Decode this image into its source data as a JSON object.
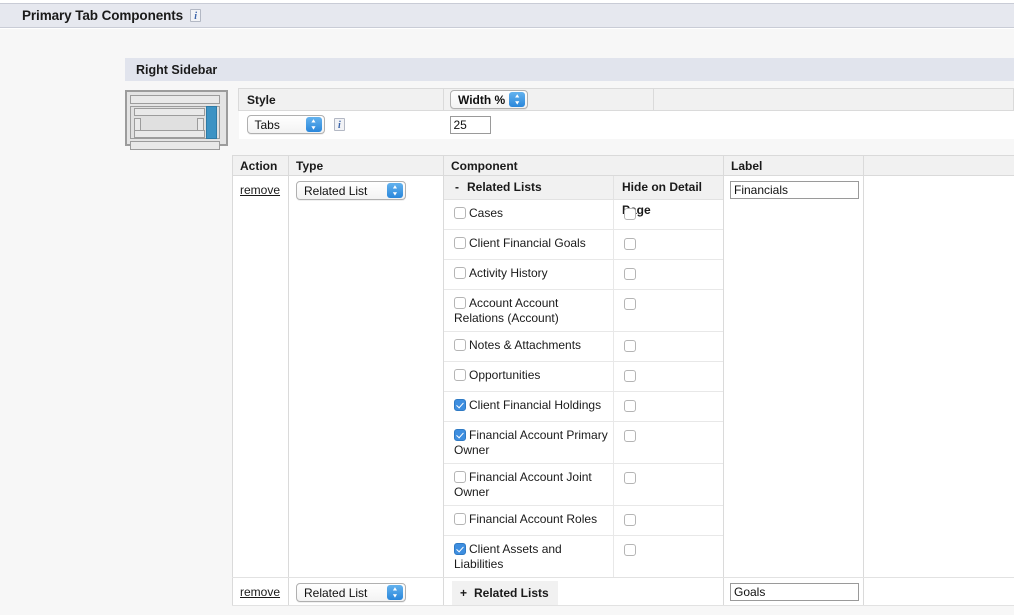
{
  "header": {
    "title": "Primary Tab Components",
    "info_icon": "info-icon",
    "info_label": "i"
  },
  "panel": {
    "title": "Right Sidebar",
    "thumbnail_name": "layout-preview-right-sidebar",
    "accent_color": "#3d93c4"
  },
  "style_section": {
    "style_header": "Style",
    "width_header_label": "Width %",
    "style_value": "Tabs",
    "style_info_label": "i",
    "width_value": "25"
  },
  "table": {
    "columns": [
      "Action",
      "Type",
      "Component",
      "Label"
    ],
    "rows": [
      {
        "action": "remove",
        "type": "Related List",
        "label": "Financials",
        "component": {
          "title": "Related Lists",
          "toggle": "-",
          "hide_column_header": "Hide on Detail Page",
          "items": [
            {
              "name": "Cases",
              "checked": false,
              "hide": false
            },
            {
              "name": "Client Financial Goals",
              "checked": false,
              "hide": false
            },
            {
              "name": "Activity History",
              "checked": false,
              "hide": false
            },
            {
              "name": "Account Account Relations (Account)",
              "checked": false,
              "hide": false
            },
            {
              "name": "Notes & Attachments",
              "checked": false,
              "hide": false
            },
            {
              "name": "Opportunities",
              "checked": false,
              "hide": false
            },
            {
              "name": "Client Financial Holdings",
              "checked": true,
              "hide": false
            },
            {
              "name": "Financial Account Primary Owner",
              "checked": true,
              "hide": false
            },
            {
              "name": "Financial Account Joint Owner",
              "checked": false,
              "hide": false
            },
            {
              "name": "Financial Account Roles",
              "checked": false,
              "hide": false
            },
            {
              "name": "Client Assets and Liabilities",
              "checked": true,
              "hide": false
            }
          ]
        }
      },
      {
        "action": "remove",
        "type": "Related List",
        "label": "Goals",
        "component": {
          "title": "Related Lists",
          "toggle": "+",
          "hide_column_header": "",
          "items": []
        }
      }
    ]
  },
  "colors": {
    "header_bg": "#e6e8ef",
    "panel_bg": "#e1e4ed",
    "checkbox_checked": "#3d8ee0",
    "select_arrow": "#2a87db"
  }
}
